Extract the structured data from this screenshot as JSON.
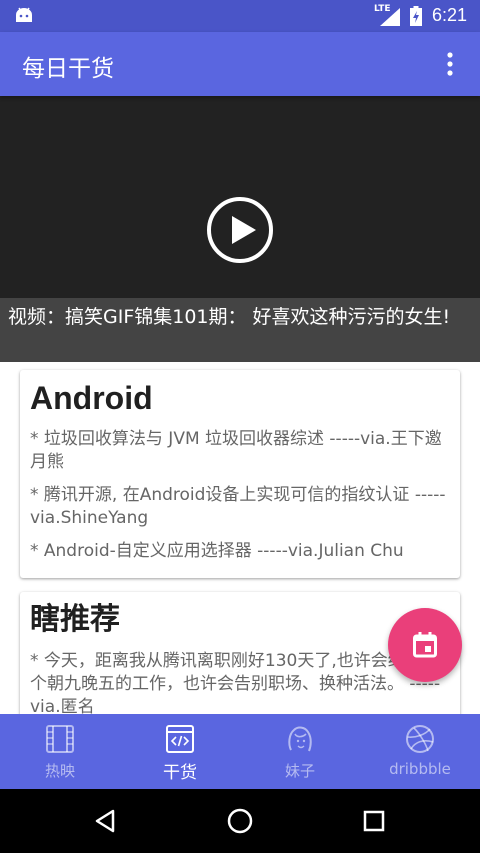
{
  "status_bar": {
    "network": "LTE",
    "time": "6:21"
  },
  "toolbar": {
    "title": "每日干货"
  },
  "video": {
    "caption": "视频：搞笑GIF锦集101期： 好喜欢这种污污的女生!"
  },
  "cards": [
    {
      "title": "Android",
      "items": [
        "* 垃圾回收算法与 JVM 垃圾回收器综述  -----via.王下邀月熊",
        "* 腾讯开源, 在Android设备上实现可信的指纹认证  -----via.ShineYang",
        "* Android-自定义应用选择器  -----via.Julian Chu"
      ]
    },
    {
      "title": "瞎推荐",
      "items": [
        "* 今天，距离我从腾讯离职刚好130天了,也许会继续找个朝九晚五的工作，也许会告别职场、换种活法。  -----via.匿名"
      ]
    }
  ],
  "bottom_nav": {
    "tabs": [
      {
        "label": "热映",
        "icon": "film-icon",
        "active": false
      },
      {
        "label": "干货",
        "icon": "code-icon",
        "active": true
      },
      {
        "label": "妹子",
        "icon": "girl-icon",
        "active": false
      },
      {
        "label": "dribbble",
        "icon": "dribbble-icon",
        "active": false
      }
    ]
  },
  "colors": {
    "status_bar": "#4a55c8",
    "primary": "#5a66e0",
    "accent": "#ea3f7a",
    "video_bg": "#222222"
  }
}
